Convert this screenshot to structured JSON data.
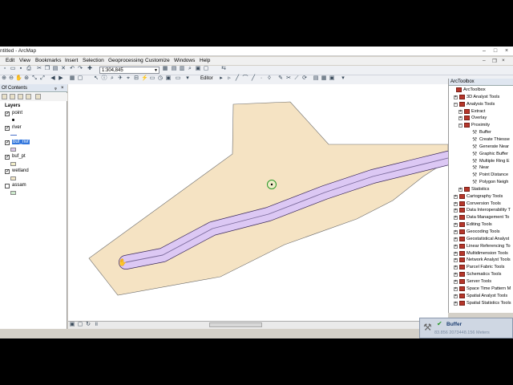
{
  "window": {
    "title": "ntitled - ArcMap"
  },
  "menu": [
    "Edit",
    "View",
    "Bookmarks",
    "Insert",
    "Selection",
    "Geoprocessing",
    "Customize",
    "Windows",
    "Help"
  ],
  "toolbar": {
    "scale_value": "1:304,845",
    "editor_label": "Editor"
  },
  "toc": {
    "title": "Of Contents",
    "root": "Layers",
    "layers": [
      {
        "name": "point",
        "checked": true,
        "selected": false,
        "symbol": "point"
      },
      {
        "name": "river",
        "checked": true,
        "selected": false,
        "symbol": "line"
      },
      {
        "name": "buf_rivr",
        "checked": true,
        "selected": true,
        "symbol": "polygon",
        "color": "#dcc8ec"
      },
      {
        "name": "buf_pt",
        "checked": true,
        "selected": false,
        "symbol": "polygon",
        "color": "#f0ecc8"
      },
      {
        "name": "wetland",
        "checked": true,
        "selected": false,
        "symbol": "polygon",
        "color": "#f4e8c8"
      },
      {
        "name": "assam",
        "checked": false,
        "selected": false,
        "symbol": "polygon",
        "color": "#cce8cc"
      }
    ]
  },
  "map": {
    "colors": {
      "wetland": "#f5e3c3",
      "buffer": "#dcc8f4",
      "river": "#7a6a9a",
      "point_buffer": "#2a9a2a"
    }
  },
  "status": {
    "coordinates": ""
  },
  "arctoolbox": {
    "title": "ArcToolbox",
    "items": [
      {
        "label": "ArcToolbox",
        "level": 0,
        "kind": "box"
      },
      {
        "label": "3D Analyst Tools",
        "level": 1,
        "kind": "box",
        "exp": "+"
      },
      {
        "label": "Analysis Tools",
        "level": 1,
        "kind": "box",
        "exp": "−"
      },
      {
        "label": "Extract",
        "level": 2,
        "kind": "box",
        "exp": "+"
      },
      {
        "label": "Overlay",
        "level": 2,
        "kind": "box",
        "exp": "+"
      },
      {
        "label": "Proximity",
        "level": 2,
        "kind": "box",
        "exp": "−"
      },
      {
        "label": "Buffer",
        "level": 3,
        "kind": "tool"
      },
      {
        "label": "Create Thiesse",
        "level": 3,
        "kind": "tool"
      },
      {
        "label": "Generate Near",
        "level": 3,
        "kind": "tool"
      },
      {
        "label": "Graphic Buffer",
        "level": 3,
        "kind": "tool"
      },
      {
        "label": "Multiple Ring E",
        "level": 3,
        "kind": "tool"
      },
      {
        "label": "Near",
        "level": 3,
        "kind": "tool"
      },
      {
        "label": "Point Distance",
        "level": 3,
        "kind": "tool"
      },
      {
        "label": "Polygon Neigh",
        "level": 3,
        "kind": "tool"
      },
      {
        "label": "Statistics",
        "level": 2,
        "kind": "box",
        "exp": "+"
      },
      {
        "label": "Cartography Tools",
        "level": 1,
        "kind": "box",
        "exp": "+"
      },
      {
        "label": "Conversion Tools",
        "level": 1,
        "kind": "box",
        "exp": "+"
      },
      {
        "label": "Data Interoperability T",
        "level": 1,
        "kind": "box",
        "exp": "+"
      },
      {
        "label": "Data Management To",
        "level": 1,
        "kind": "box",
        "exp": "+"
      },
      {
        "label": "Editing Tools",
        "level": 1,
        "kind": "box",
        "exp": "+"
      },
      {
        "label": "Geocoding Tools",
        "level": 1,
        "kind": "box",
        "exp": "+"
      },
      {
        "label": "Geostatistical Analyst",
        "level": 1,
        "kind": "box",
        "exp": "+"
      },
      {
        "label": "Linear Referencing To",
        "level": 1,
        "kind": "box",
        "exp": "+"
      },
      {
        "label": "Multidimension Tools",
        "level": 1,
        "kind": "box",
        "exp": "+"
      },
      {
        "label": "Network Analyst Tools",
        "level": 1,
        "kind": "box",
        "exp": "+"
      },
      {
        "label": "Parcel Fabric Tools",
        "level": 1,
        "kind": "box",
        "exp": "+"
      },
      {
        "label": "Schematics Tools",
        "level": 1,
        "kind": "box",
        "exp": "+"
      },
      {
        "label": "Server Tools",
        "level": 1,
        "kind": "box",
        "exp": "+"
      },
      {
        "label": "Space Time Pattern M",
        "level": 1,
        "kind": "box",
        "exp": "+"
      },
      {
        "label": "Spatial Analyst Tools",
        "level": 1,
        "kind": "box",
        "exp": "+"
      },
      {
        "label": "Spatial Statistics Tools",
        "level": 1,
        "kind": "box",
        "exp": "+"
      }
    ]
  },
  "buffer_notification": {
    "title": "Buffer",
    "coords": "83.856  2073448.156 Meters"
  }
}
